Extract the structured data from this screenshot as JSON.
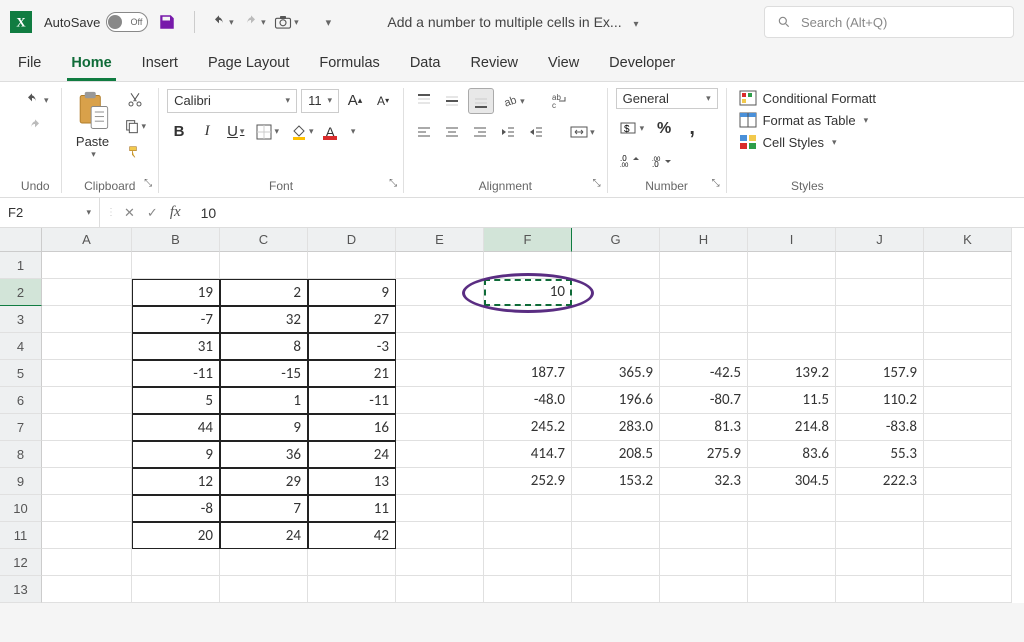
{
  "title_bar": {
    "autosave_label": "AutoSave",
    "autosave_state": "Off",
    "doc_name": "Add a number to multiple cells in Ex...",
    "search_placeholder": "Search (Alt+Q)"
  },
  "tabs": [
    "File",
    "Home",
    "Insert",
    "Page Layout",
    "Formulas",
    "Data",
    "Review",
    "View",
    "Developer"
  ],
  "active_tab": "Home",
  "ribbon": {
    "undo_label": "Undo",
    "clipboard": {
      "paste_label": "Paste",
      "group_label": "Clipboard"
    },
    "font": {
      "font_name": "Calibri",
      "font_size": "11",
      "group_label": "Font"
    },
    "alignment": {
      "group_label": "Alignment"
    },
    "number": {
      "format": "General",
      "group_label": "Number"
    },
    "styles": {
      "conditional": "Conditional Formatt",
      "table": "Format as Table",
      "cell_styles": "Cell Styles",
      "group_label": "Styles"
    }
  },
  "name_box": "F2",
  "formula_value": "10",
  "columns": [
    "A",
    "B",
    "C",
    "D",
    "E",
    "F",
    "G",
    "H",
    "I",
    "J",
    "K"
  ],
  "rows": [
    "1",
    "2",
    "3",
    "4",
    "5",
    "6",
    "7",
    "8",
    "9",
    "10",
    "11",
    "12",
    "13"
  ],
  "grid": {
    "B": {
      "2": "19",
      "3": "-7",
      "4": "31",
      "5": "-11",
      "6": "5",
      "7": "44",
      "8": "9",
      "9": "12",
      "10": "-8",
      "11": "20"
    },
    "C": {
      "2": "2",
      "3": "32",
      "4": "8",
      "5": "-15",
      "6": "1",
      "7": "9",
      "8": "36",
      "9": "29",
      "10": "7",
      "11": "24"
    },
    "D": {
      "2": "9",
      "3": "27",
      "4": "-3",
      "5": "21",
      "6": "-11",
      "7": "16",
      "8": "24",
      "9": "13",
      "10": "11",
      "11": "42"
    },
    "F": {
      "2": "10",
      "5": "187.7",
      "6": "-48.0",
      "7": "245.2",
      "8": "414.7",
      "9": "252.9"
    },
    "G": {
      "5": "365.9",
      "6": "196.6",
      "7": "283.0",
      "8": "208.5",
      "9": "153.2"
    },
    "H": {
      "5": "-42.5",
      "6": "-80.7",
      "7": "81.3",
      "8": "275.9",
      "9": "32.3"
    },
    "I": {
      "5": "139.2",
      "6": "11.5",
      "7": "214.8",
      "8": "83.6",
      "9": "304.5"
    },
    "J": {
      "5": "157.9",
      "6": "110.2",
      "7": "-83.8",
      "8": "55.3",
      "9": "222.3"
    }
  },
  "bordered_range": {
    "cols": [
      "B",
      "C",
      "D"
    ],
    "row_start": 2,
    "row_end": 11
  },
  "selected_cell": "F2",
  "highlight_col": "F",
  "highlight_row": "2"
}
